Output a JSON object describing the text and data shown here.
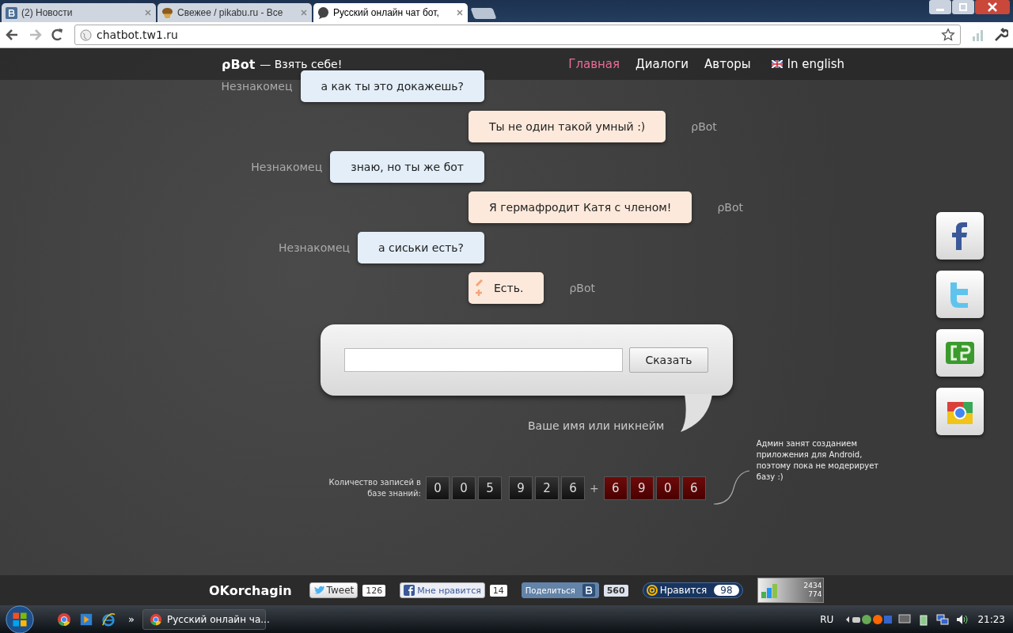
{
  "browser": {
    "tabs": [
      {
        "title": "(2) Новости",
        "selected": false
      },
      {
        "title": "Свежее / pikabu.ru - Все",
        "selected": false
      },
      {
        "title": "Русский онлайн чат бот,",
        "selected": true
      }
    ],
    "url": "chatbot.tw1.ru"
  },
  "header": {
    "logo": "ρBot",
    "tagline": "— Взять себе!",
    "nav": [
      {
        "label": "Главная",
        "selected": true
      },
      {
        "label": "Диалоги",
        "selected": false
      },
      {
        "label": "Авторы",
        "selected": false
      }
    ],
    "language": "In english"
  },
  "messages": [
    {
      "kind": "user",
      "author": "Незнакомец",
      "text": "а как ты это докажешь?"
    },
    {
      "kind": "bot",
      "author": "ρBot",
      "text": "Ты не один такой умный :)"
    },
    {
      "kind": "user",
      "author": "Незнакомец",
      "text": "знаю, но ты же бот"
    },
    {
      "kind": "bot",
      "author": "ρBot",
      "text": "Я гермафродит Катя с членом!"
    },
    {
      "kind": "user",
      "author": "Незнакомец",
      "text": "а сиськи есть?"
    },
    {
      "kind": "bot",
      "author": "ρBot",
      "text": "Есть.",
      "rate": true
    }
  ],
  "composer": {
    "button": "Сказать",
    "name_hint": "Ваше имя или никнейм"
  },
  "counter": {
    "label": "Количество записей в базе знаний:",
    "digits": [
      "0",
      "0",
      "5",
      "9",
      "2",
      "6"
    ],
    "plus": "+",
    "pending": [
      "6",
      "9",
      "0",
      "6"
    ],
    "note": "Админ занят созданием приложения для Android, поэтому пока не модерирует базу :)"
  },
  "footer": {
    "author": "OKorchagin",
    "shares": [
      {
        "kind": "twitter",
        "label": "Tweet",
        "count": "126"
      },
      {
        "kind": "facebook",
        "label": "Мне нравится",
        "count": "14"
      },
      {
        "kind": "vk",
        "label": "Поделиться",
        "count": "560"
      },
      {
        "kind": "mail",
        "label": "Нравится",
        "count": "98"
      }
    ],
    "stats": [
      "2434",
      "774"
    ]
  },
  "taskbar": {
    "chevron": "»",
    "window": "Русский онлайн ча...",
    "lang": "RU",
    "time": "21:23"
  }
}
